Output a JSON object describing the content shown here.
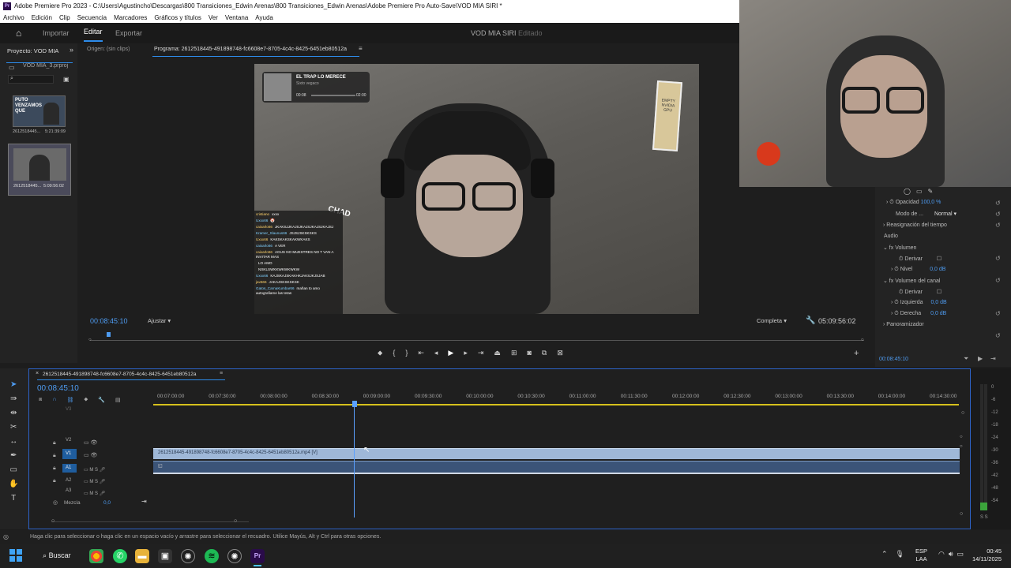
{
  "window": {
    "title": "Adobe Premiere Pro 2023 - C:\\Users\\Agustincho\\Descargas\\800 Transiciones_Edwin Arenas\\800 Transiciones_Edwin Arenas\\Adobe Premiere Pro Auto-Save\\VOD MIA SIRI *"
  },
  "menu": [
    "Archivo",
    "Edición",
    "Clip",
    "Secuencia",
    "Marcadores",
    "Gráficos y títulos",
    "Ver",
    "Ventana",
    "Ayuda"
  ],
  "workspace": {
    "home": "home-icon",
    "tabs": [
      "Importar",
      "Editar",
      "Exportar"
    ],
    "active": "Editar",
    "project_title": "VOD MIA SIRI",
    "status": "Editado"
  },
  "project": {
    "panel_title": "Proyecto: VOD MIA",
    "file": "VOD MIA_3.prproj",
    "items": [
      {
        "name": "2612518445...",
        "duration": "5:21:39:09",
        "thumb_text": "PUTO VENZAMOS QUE"
      },
      {
        "name": "2612518445...",
        "duration": "5:09:56:02"
      }
    ]
  },
  "source": {
    "label": "Origen: (sin clips)"
  },
  "program": {
    "title": "Programa: 2612518445-491898748-fc6608e7-8705-4c4c-8425-6451eb80512a",
    "timecode": "00:08:45:10",
    "fit": "Ajustar",
    "quality": "Completa",
    "duration": "05:09:56:02"
  },
  "overlay": {
    "player_title": "EL TRAP LO MERECE",
    "player_artist": "Sixto vegaco",
    "player_time_start": "00:08",
    "player_time_end": "02:00",
    "chad_label": "CHAD",
    "sticker": "EMPTY\nNVIDIA\nGPU",
    "chat": [
      {
        "user": "cristiano",
        "msg": "xxxx"
      },
      {
        "user": "Uxxx66",
        "msg": "🤡"
      },
      {
        "user": "caixarlo66",
        "msg": "JKAKSJJKAJSJKAJSJKAJSJKAJSJ"
      },
      {
        "user": "Kramer_Slaunus66",
        "msg": "JSJSJSKSKSKS"
      },
      {
        "user": "Uxxx66",
        "msg": "KAKSKAKSKAKWKAKS"
      },
      {
        "user": "caixarlo66",
        "msg": "A VER"
      },
      {
        "user": "caixarlo66",
        "msg": "AGUS NO MUESTRES NO T VAN A INVITAR MAS"
      },
      {
        "user": "",
        "msg": "LO AMO"
      },
      {
        "user": "",
        "msg": "NSKLSWKKWKWKWKW"
      },
      {
        "user": "Uxxx66",
        "msg": "KAJSKAJSKAKHKJAKSJKJSJAB"
      },
      {
        "user": "jav666",
        "msg": "JAKAJSKSKSKSK"
      },
      {
        "user": "Gatos_CarnaKumbar66",
        "msg": "mañan to amo autografiame las tetas"
      }
    ]
  },
  "effect_controls": {
    "opacity_label": "Opacidad",
    "opacity_value": "100,0 %",
    "blend_label": "Modo de ...",
    "blend_value": "Normal",
    "time_remap": "Reasignación del tiempo",
    "audio": "Audio",
    "volume": "Volumen",
    "bypass": "Derivar",
    "level": "Nivel",
    "level_value": "0,0 dB",
    "channel_volume": "Volumen del canal",
    "left": "Izquierda",
    "left_value": "0,0 dB",
    "right": "Derecha",
    "right_value": "0,0 dB",
    "panner": "Panoramizador",
    "timecode": "00:08:45:10"
  },
  "timeline": {
    "sequence_name": "2612518445-491898748-fc6608e7-8705-4c4c-8425-6451eb80512a",
    "timecode": "00:08:45:10",
    "ruler": [
      "00:07:00:00",
      "00:07:30:00",
      "00:08:00:00",
      "00:08:30:00",
      "00:09:00:00",
      "00:09:30:00",
      "00:10:00:00",
      "00:10:30:00",
      "00:11:00:00",
      "00:11:30:00",
      "00:12:00:00",
      "00:12:30:00",
      "00:13:00:00",
      "00:13:30:00",
      "00:14:00:00",
      "00:14:30:00"
    ],
    "tracks": [
      "V3",
      "V2",
      "V1",
      "A1",
      "A2",
      "A3"
    ],
    "mix_label": "Mezcla",
    "mix_value": "0,0",
    "video_clip": "2612518445-491898748-fc6608e7-8705-4c4c-8425-6451eb80512a.mp4 [V]"
  },
  "meter": {
    "scale": [
      "0",
      "-6",
      "-12",
      "-18",
      "-24",
      "-30",
      "-36",
      "-42",
      "-48",
      "-54"
    ],
    "footer": "S S"
  },
  "status": "Haga clic para seleccionar o haga clic en un espacio vacío y arrastre para seleccionar el recuadro. Utilice Mayús, Alt y Ctrl para otras opciones.",
  "taskbar": {
    "search": "Buscar",
    "lang": "ESP",
    "lang2": "LAA",
    "time": "00:45",
    "date": "14/11/2025"
  },
  "colors": {
    "accent": "#2d8ceb",
    "clip_video": "#9fb8d8",
    "clip_audio": "#3b5478",
    "playhead": "#5aa0ff"
  }
}
